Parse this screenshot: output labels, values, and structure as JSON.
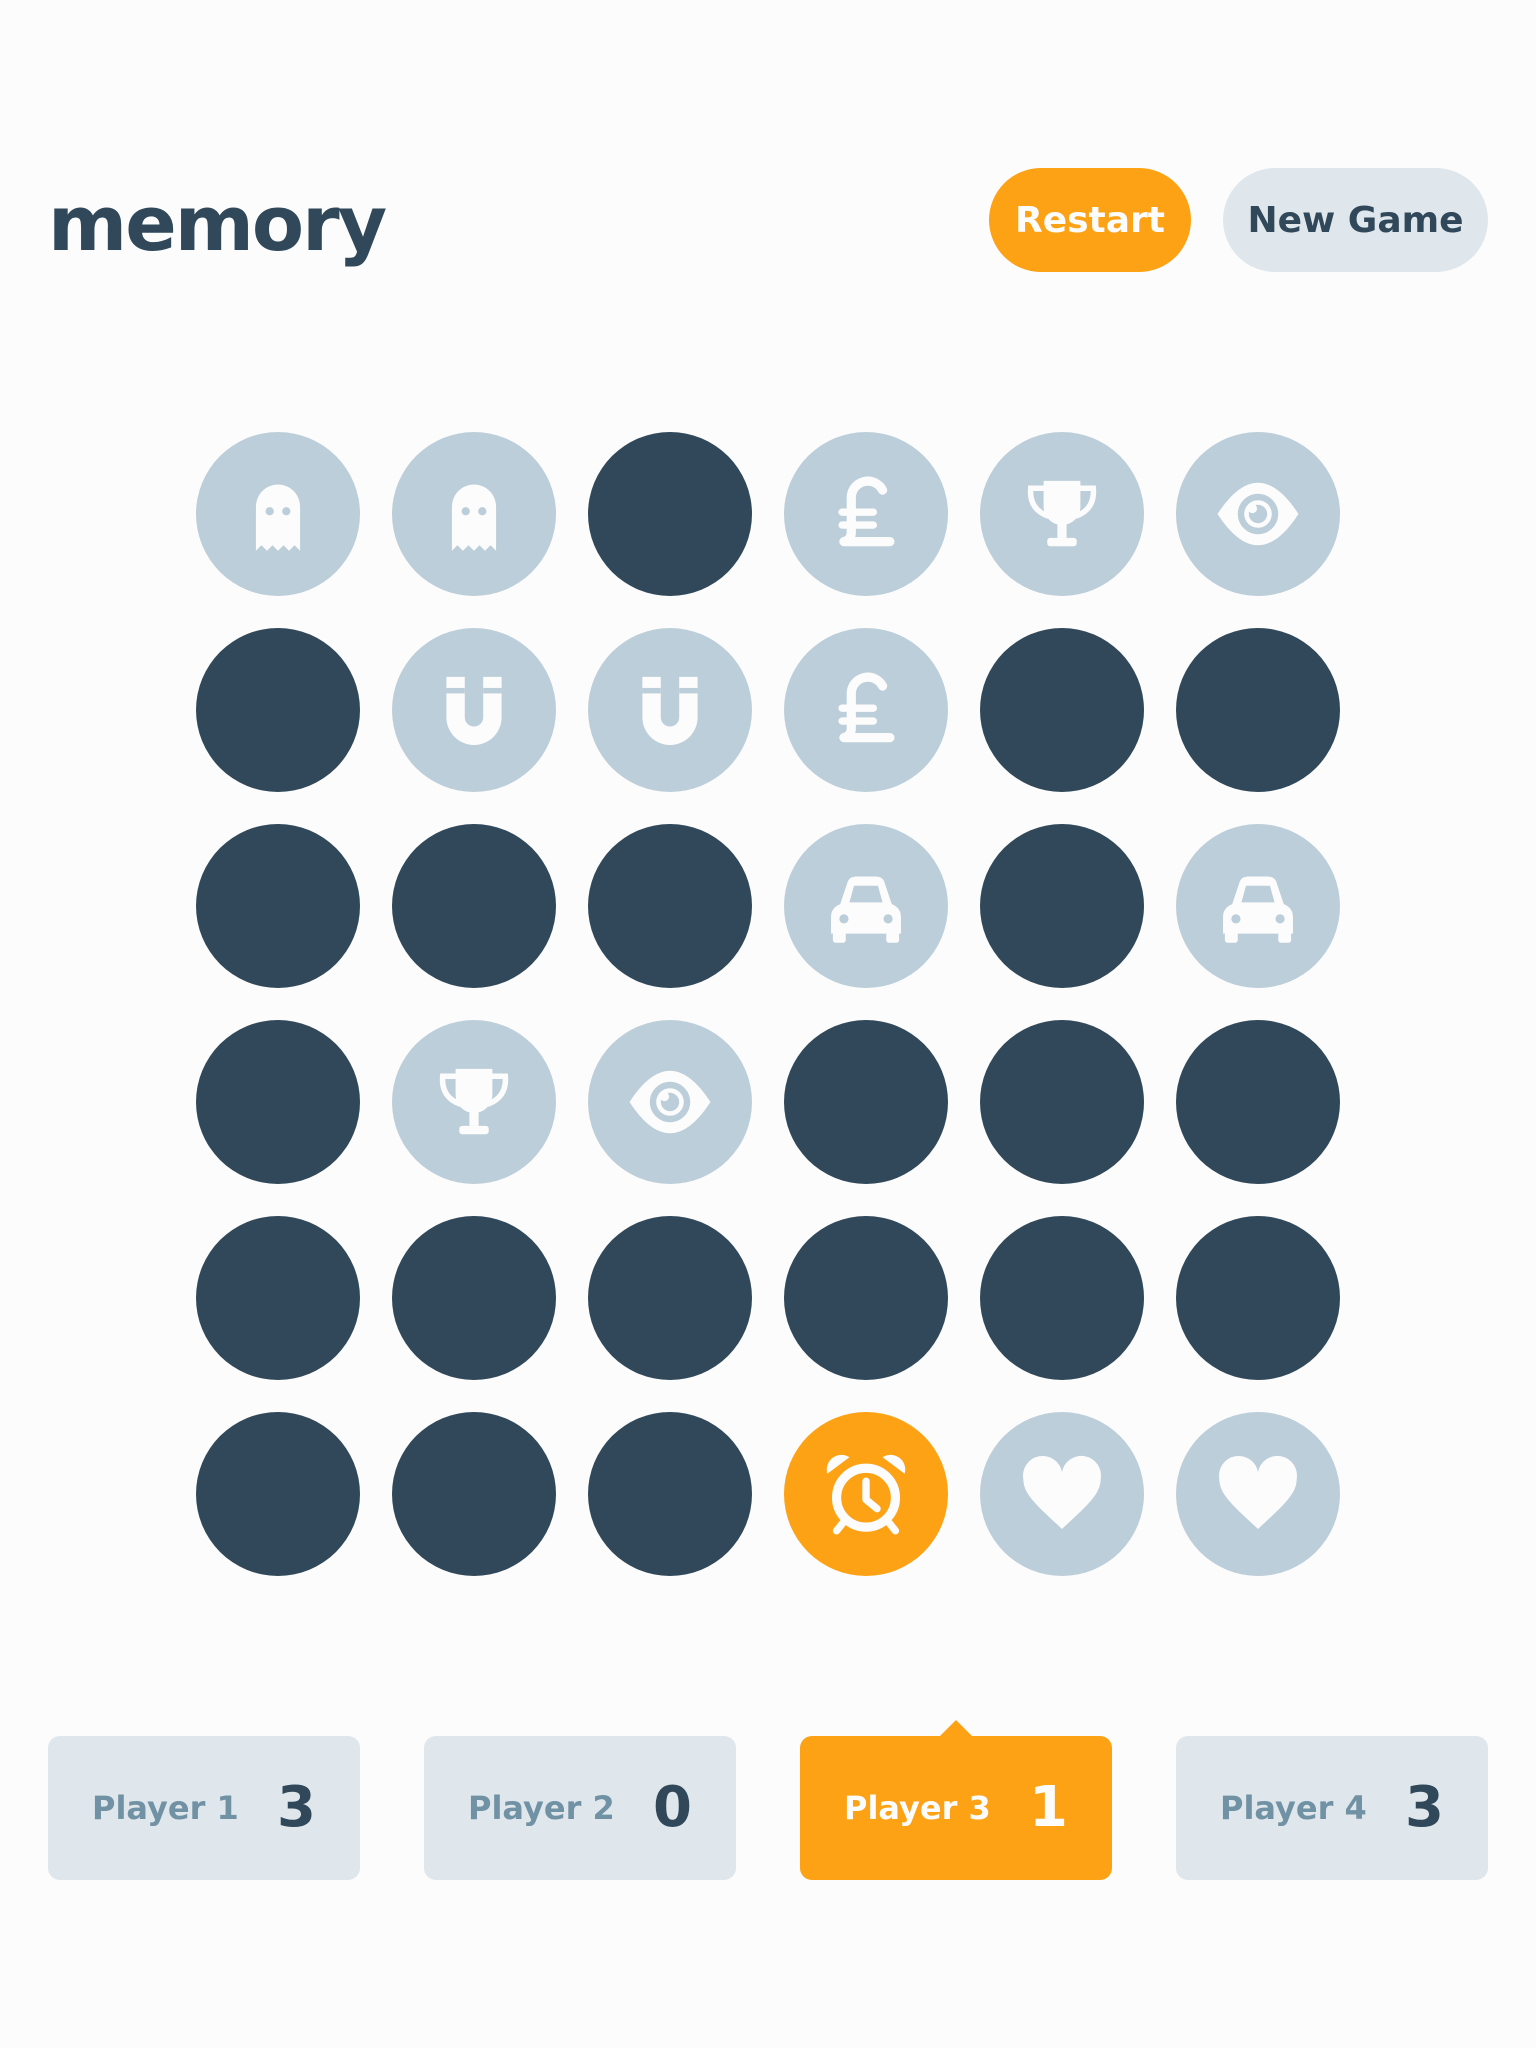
{
  "header": {
    "title": "memory",
    "restart_label": "Restart",
    "new_game_label": "New Game"
  },
  "colors": {
    "hidden": "#304859",
    "matched": "#BCCED9",
    "active": "#FDA214",
    "icon": "#FCFCFC"
  },
  "board": {
    "size": 6,
    "tiles": [
      {
        "state": "matched",
        "icon": "ghost-icon"
      },
      {
        "state": "matched",
        "icon": "ghost-icon"
      },
      {
        "state": "hidden",
        "icon": ""
      },
      {
        "state": "matched",
        "icon": "pound-sign-icon"
      },
      {
        "state": "matched",
        "icon": "trophy-icon"
      },
      {
        "state": "matched",
        "icon": "eye-icon"
      },
      {
        "state": "hidden",
        "icon": ""
      },
      {
        "state": "matched",
        "icon": "magnet-icon"
      },
      {
        "state": "matched",
        "icon": "magnet-icon"
      },
      {
        "state": "matched",
        "icon": "pound-sign-icon"
      },
      {
        "state": "hidden",
        "icon": ""
      },
      {
        "state": "hidden",
        "icon": ""
      },
      {
        "state": "hidden",
        "icon": ""
      },
      {
        "state": "hidden",
        "icon": ""
      },
      {
        "state": "hidden",
        "icon": ""
      },
      {
        "state": "matched",
        "icon": "car-icon"
      },
      {
        "state": "hidden",
        "icon": ""
      },
      {
        "state": "matched",
        "icon": "car-icon"
      },
      {
        "state": "hidden",
        "icon": ""
      },
      {
        "state": "matched",
        "icon": "trophy-icon"
      },
      {
        "state": "matched",
        "icon": "eye-icon"
      },
      {
        "state": "hidden",
        "icon": ""
      },
      {
        "state": "hidden",
        "icon": ""
      },
      {
        "state": "hidden",
        "icon": ""
      },
      {
        "state": "hidden",
        "icon": ""
      },
      {
        "state": "hidden",
        "icon": ""
      },
      {
        "state": "hidden",
        "icon": ""
      },
      {
        "state": "hidden",
        "icon": ""
      },
      {
        "state": "hidden",
        "icon": ""
      },
      {
        "state": "hidden",
        "icon": ""
      },
      {
        "state": "hidden",
        "icon": ""
      },
      {
        "state": "hidden",
        "icon": ""
      },
      {
        "state": "hidden",
        "icon": ""
      },
      {
        "state": "active",
        "icon": "alarm-clock-icon"
      },
      {
        "state": "matched",
        "icon": "heart-icon"
      },
      {
        "state": "matched",
        "icon": "heart-icon"
      }
    ]
  },
  "players": [
    {
      "name": "Player 1",
      "score": "3",
      "current": false
    },
    {
      "name": "Player 2",
      "score": "0",
      "current": false
    },
    {
      "name": "Player 3",
      "score": "1",
      "current": true
    },
    {
      "name": "Player 4",
      "score": "3",
      "current": false
    }
  ]
}
